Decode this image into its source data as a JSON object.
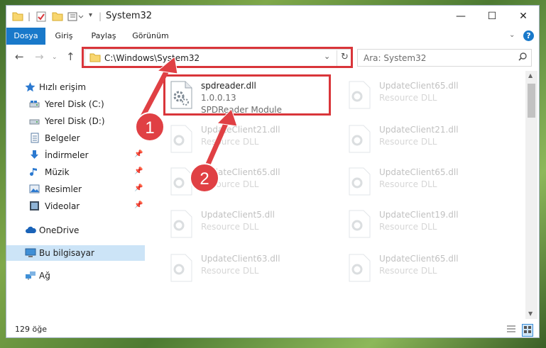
{
  "window": {
    "title": "System32",
    "controls": {
      "minimize": "—",
      "maximize": "☐",
      "close": "✕"
    }
  },
  "ribbon": {
    "tabs": [
      {
        "label": "Dosya",
        "active": true
      },
      {
        "label": "Giriş",
        "active": false
      },
      {
        "label": "Paylaş",
        "active": false
      },
      {
        "label": "Görünüm",
        "active": false
      }
    ],
    "help": "?"
  },
  "address": {
    "path": "C:\\Windows\\System32",
    "search_placeholder": "Ara: System32"
  },
  "sidebar": {
    "items": [
      {
        "label": "Hızlı erişim",
        "icon": "star-icon"
      },
      {
        "label": "Yerel Disk (C:)",
        "icon": "drive-icon"
      },
      {
        "label": "Yerel Disk (D:)",
        "icon": "drive-icon"
      },
      {
        "label": "Belgeler",
        "icon": "documents-icon"
      },
      {
        "label": "İndirmeler",
        "icon": "download-icon"
      },
      {
        "label": "Müzik",
        "icon": "music-icon"
      },
      {
        "label": "Resimler",
        "icon": "pictures-icon"
      },
      {
        "label": "Videolar",
        "icon": "video-icon"
      },
      {
        "label": "OneDrive",
        "icon": "cloud-icon"
      },
      {
        "label": "Bu bilgisayar",
        "icon": "computer-icon"
      },
      {
        "label": "Ağ",
        "icon": "network-icon"
      }
    ]
  },
  "files": {
    "highlighted": {
      "name": "spdreader.dll",
      "version": "1.0.0.13",
      "description": "SPDReader Module"
    },
    "others": [
      {
        "name": "UpdateClient65.dll",
        "type": "Resource DLL"
      },
      {
        "name": "UpdateClient21.dll",
        "type": "Resource DLL"
      },
      {
        "name": "UpdateClient21.dll",
        "type": "Resource DLL"
      },
      {
        "name": "UpdateClient65.dll",
        "type": "Resource DLL"
      },
      {
        "name": "UpdateClient65.dll",
        "type": "Resource DLL"
      },
      {
        "name": "UpdateClient5.dll",
        "type": "Resource DLL"
      },
      {
        "name": "UpdateClient19.dll",
        "type": "Resource DLL"
      },
      {
        "name": "UpdateClient63.dll",
        "type": "Resource DLL"
      },
      {
        "name": "UpdateClient65.dll",
        "type": "Resource DLL"
      }
    ]
  },
  "status": {
    "count": "129 öğe"
  },
  "callouts": [
    "1",
    "2"
  ],
  "colors": {
    "accent": "#1979ca",
    "highlight": "#d9353a",
    "selected": "#cce4f7"
  }
}
